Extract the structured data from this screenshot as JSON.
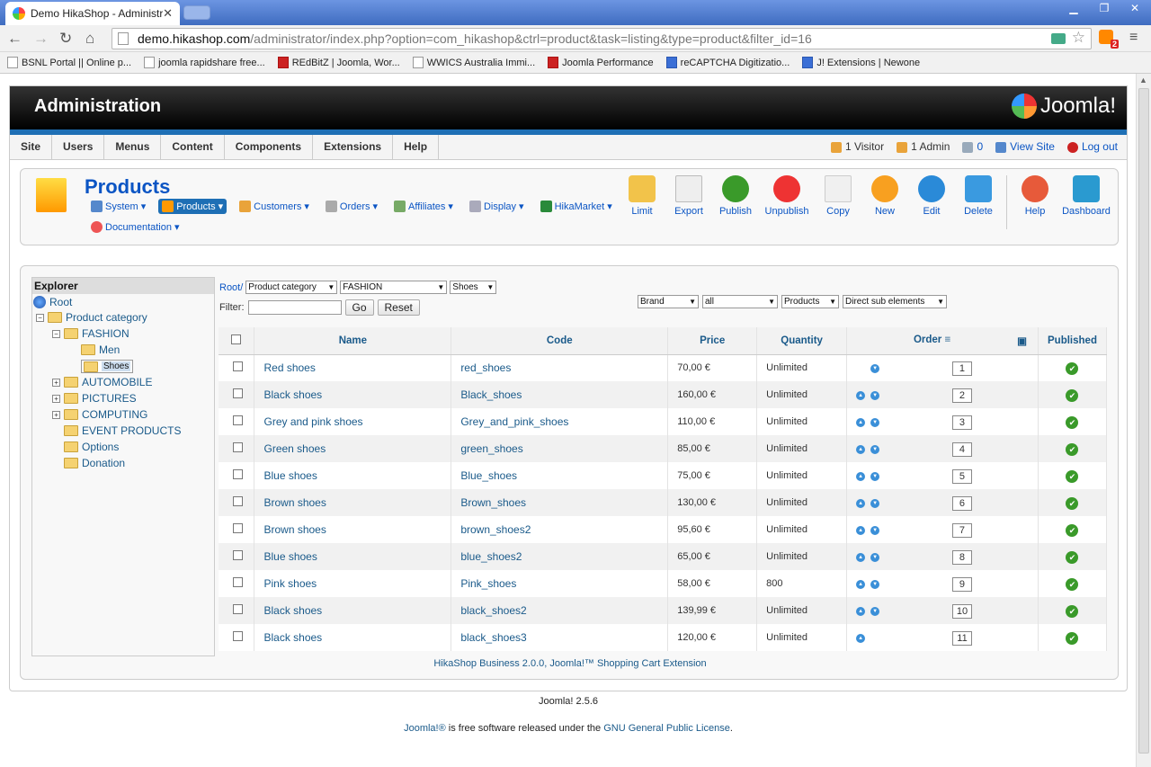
{
  "browser": {
    "tab_title": "Demo HikaShop - Administrat",
    "url_host": "demo.hikashop.com",
    "url_path": "/administrator/index.php?option=com_hikashop&ctrl=product&task=listing&type=product&filter_id=16",
    "rss_badge": "2"
  },
  "bookmarks": [
    "BSNL Portal || Online p...",
    "joomla rapidshare free...",
    "REdBitZ | Joomla, Wor...",
    "WWICS Australia Immi...",
    "Joomla Performance",
    "reCAPTCHA Digitizatio...",
    "J! Extensions | Newone"
  ],
  "header": {
    "title": "Administration",
    "logo": "Joomla!"
  },
  "menu": {
    "items": [
      "Site",
      "Users",
      "Menus",
      "Content",
      "Components",
      "Extensions",
      "Help"
    ],
    "visitor": "1 Visitor",
    "admin": "1 Admin",
    "messages": "0",
    "view_site": "View Site",
    "logout": "Log out"
  },
  "page": {
    "title": "Products",
    "submenu": [
      "System",
      "Products",
      "Customers",
      "Orders",
      "Affiliates",
      "Display",
      "HikaMarket"
    ],
    "documentation": "Documentation"
  },
  "toolbar": [
    "Limit",
    "Export",
    "Publish",
    "Unpublish",
    "Copy",
    "New",
    "Edit",
    "Delete",
    "Help",
    "Dashboard"
  ],
  "explorer": {
    "title": "Explorer",
    "root": "Root",
    "product_category": "Product category",
    "fashion": "FASHION",
    "men": "Men",
    "shoes": "Shoes",
    "automobile": "AUTOMOBILE",
    "pictures": "PICTURES",
    "computing": "COMPUTING",
    "event": "EVENT PRODUCTS",
    "options": "Options",
    "donation": "Donation"
  },
  "filters": {
    "root": "Root/",
    "cat1": "Product category",
    "cat2": "FASHION",
    "cat3": "Shoes",
    "filter_label": "Filter:",
    "go": "Go",
    "reset": "Reset",
    "brand": "Brand",
    "all": "all",
    "products": "Products",
    "direct": "Direct sub elements"
  },
  "table": {
    "headers": [
      "Name",
      "Code",
      "Price",
      "Quantity",
      "Order",
      "Published"
    ],
    "rows": [
      {
        "name": "Red shoes",
        "code": "red_shoes",
        "price": "70,00 €",
        "qty": "Unlimited",
        "order": "1"
      },
      {
        "name": "Black shoes",
        "code": "Black_shoes",
        "price": "160,00 €",
        "qty": "Unlimited",
        "order": "2"
      },
      {
        "name": "Grey and pink shoes",
        "code": "Grey_and_pink_shoes",
        "price": "110,00 €",
        "qty": "Unlimited",
        "order": "3"
      },
      {
        "name": "Green shoes",
        "code": "green_shoes",
        "price": "85,00 €",
        "qty": "Unlimited",
        "order": "4"
      },
      {
        "name": "Blue shoes",
        "code": "Blue_shoes",
        "price": "75,00 €",
        "qty": "Unlimited",
        "order": "5"
      },
      {
        "name": "Brown shoes",
        "code": "Brown_shoes",
        "price": "130,00 €",
        "qty": "Unlimited",
        "order": "6"
      },
      {
        "name": "Brown shoes",
        "code": "brown_shoes2",
        "price": "95,60 €",
        "qty": "Unlimited",
        "order": "7"
      },
      {
        "name": "Blue shoes",
        "code": "blue_shoes2",
        "price": "65,00 €",
        "qty": "Unlimited",
        "order": "8"
      },
      {
        "name": "Pink shoes",
        "code": "Pink_shoes",
        "price": "58,00 €",
        "qty": "800",
        "order": "9"
      },
      {
        "name": "Black shoes",
        "code": "black_shoes2",
        "price": "139,99 €",
        "qty": "Unlimited",
        "order": "10"
      },
      {
        "name": "Black shoes",
        "code": "black_shoes3",
        "price": "120,00 €",
        "qty": "Unlimited",
        "order": "11"
      }
    ]
  },
  "version": "HikaShop Business 2.0.0, Joomla!™ Shopping Cart Extension",
  "footer": {
    "joomla_version": "Joomla! 2.5.6",
    "joomla_link": "Joomla!®",
    "free_text": " is free software released under the ",
    "license": "GNU General Public License",
    "dot": "."
  }
}
